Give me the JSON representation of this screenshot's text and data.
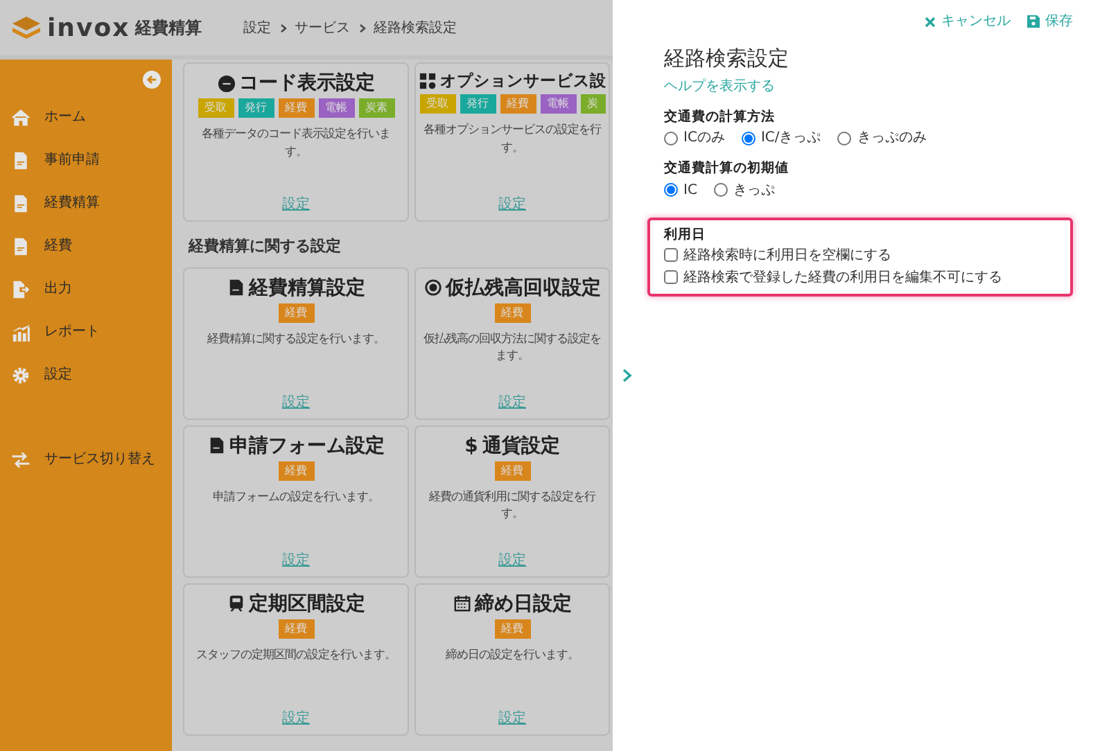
{
  "header": {
    "logo_text": "invox",
    "product": "経費精算",
    "breadcrumb": [
      "設定",
      "サービス",
      "経路検索設定"
    ]
  },
  "sidebar": {
    "items": [
      {
        "label": "ホーム"
      },
      {
        "label": "事前申請"
      },
      {
        "label": "経費精算"
      },
      {
        "label": "経費"
      },
      {
        "label": "出力"
      },
      {
        "label": "レポート"
      },
      {
        "label": "設定"
      },
      {
        "label": "サービス切り替え"
      }
    ]
  },
  "sections": [
    {
      "cards": [
        {
          "title": "コード表示設定",
          "tags": [
            {
              "text": "受取",
              "color": "#c9a500"
            },
            {
              "text": "発行",
              "color": "#1aa89c"
            },
            {
              "text": "経費",
              "color": "#d8861c"
            },
            {
              "text": "電帳",
              "color": "#9a62c2"
            },
            {
              "text": "炭素",
              "color": "#7bad2a"
            }
          ],
          "desc_lines": [
            "各種データのコード表示設定を行いま",
            "す。"
          ],
          "link": "設定"
        },
        {
          "title": "オプションサービス設",
          "tags": [
            {
              "text": "受取",
              "color": "#c9a500"
            },
            {
              "text": "発行",
              "color": "#1aa89c"
            },
            {
              "text": "経費",
              "color": "#d8861c"
            },
            {
              "text": "電帳",
              "color": "#9a62c2"
            },
            {
              "text": "炭",
              "color": "#7bad2a"
            }
          ],
          "desc_lines": [
            "各種オプションサービスの設定を行",
            "す。"
          ],
          "link": "設定"
        }
      ]
    },
    {
      "title": "経費精算に関する設定",
      "cards": [
        {
          "title": "経費精算設定",
          "tags": [
            {
              "text": "経費",
              "color": "#d8861c"
            }
          ],
          "desc_lines": [
            "経費精算に関する設定を行います。"
          ],
          "link": "設定"
        },
        {
          "title": "仮払残高回収設定",
          "tags": [
            {
              "text": "経費",
              "color": "#d8861c"
            }
          ],
          "desc_lines": [
            "仮払残高の回収方法に関する設定を",
            "ます。"
          ],
          "link": "設定"
        },
        {
          "title": "申請フォーム設定",
          "tags": [
            {
              "text": "経費",
              "color": "#d8861c"
            }
          ],
          "desc_lines": [
            "申請フォームの設定を行います。"
          ],
          "link": "設定"
        },
        {
          "title": "通貨設定",
          "symbol": "$",
          "tags": [
            {
              "text": "経費",
              "color": "#d8861c"
            }
          ],
          "desc_lines": [
            "経費の通貨利用に関する設定を行",
            "す。"
          ],
          "link": "設定"
        },
        {
          "title": "定期区間設定",
          "tags": [
            {
              "text": "経費",
              "color": "#d8861c"
            }
          ],
          "desc_lines": [
            "スタッフの定期区間の設定を行います。"
          ],
          "link": "設定"
        },
        {
          "title": "締め日設定",
          "tags": [
            {
              "text": "経費",
              "color": "#d8861c"
            }
          ],
          "desc_lines": [
            "締め日の設定を行います。"
          ],
          "link": "設定"
        }
      ]
    }
  ],
  "panel": {
    "cancel": "キャンセル",
    "save": "保存",
    "title": "経路検索設定",
    "help_link": "ヘルプを表示する",
    "groups": [
      {
        "kind": "radio",
        "label": "交通費の計算方法",
        "options": [
          {
            "label": "ICのみ",
            "selected": false
          },
          {
            "label": "IC/きっぷ",
            "selected": true
          },
          {
            "label": "きっぷのみ",
            "selected": false
          }
        ]
      },
      {
        "kind": "radio",
        "label": "交通費計算の初期値",
        "options": [
          {
            "label": "IC",
            "selected": true
          },
          {
            "label": "きっぷ",
            "selected": false
          }
        ]
      },
      {
        "kind": "checkbox",
        "label": "利用日",
        "highlighted": true,
        "options": [
          {
            "label": "経路検索時に利用日を空欄にする",
            "checked": false
          },
          {
            "label": "経路検索で登録した経費の利用日を編集不可にする",
            "checked": false
          }
        ]
      }
    ]
  }
}
